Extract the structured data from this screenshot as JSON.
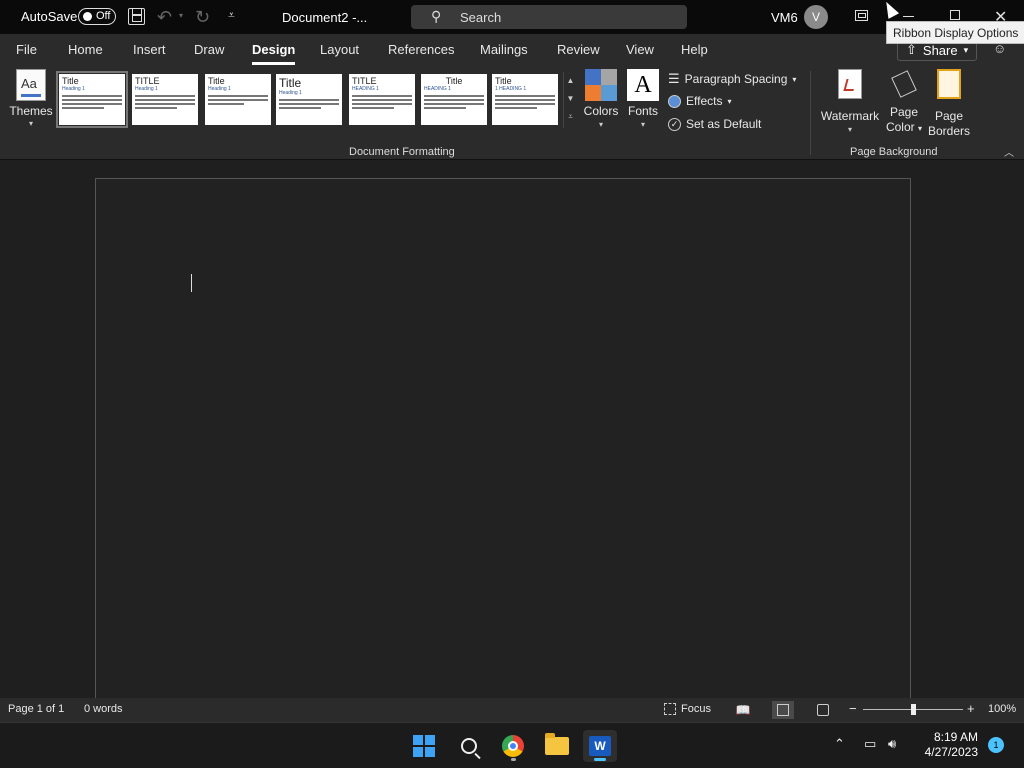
{
  "titlebar": {
    "autosave_label": "AutoSave",
    "autosave_state": "Off",
    "doc_title": "Document2  -...",
    "search_placeholder": "Search",
    "user_name": "VM6",
    "avatar_initial": "V",
    "tooltip": "Ribbon Display Options"
  },
  "tabs": [
    "File",
    "Home",
    "Insert",
    "Draw",
    "Design",
    "Layout",
    "References",
    "Mailings",
    "Review",
    "View",
    "Help"
  ],
  "active_tab": "Design",
  "share_label": "Share",
  "ribbon": {
    "themes_label": "Themes",
    "style_gallery": [
      {
        "title": "Title",
        "heading": "Heading 1"
      },
      {
        "title": "TITLE",
        "heading": "Heading 1"
      },
      {
        "title": "Title",
        "heading": "Heading 1"
      },
      {
        "title": "Title",
        "heading": "Heading 1"
      },
      {
        "title": "TITLE",
        "heading": "HEADING 1"
      },
      {
        "title": "Title",
        "heading": "HEADING 1"
      },
      {
        "title": "Title",
        "heading": "1  HEADING 1"
      }
    ],
    "colors_label": "Colors",
    "fonts_label": "Fonts",
    "fonts_glyph": "A",
    "paragraph_spacing_label": "Paragraph Spacing",
    "effects_label": "Effects",
    "set_default_label": "Set as Default",
    "watermark_label": "Watermark",
    "page_color_label1": "Page",
    "page_color_label2": "Color",
    "page_borders_label1": "Page",
    "page_borders_label2": "Borders",
    "group_document_formatting": "Document Formatting",
    "group_page_background": "Page Background",
    "colors": {
      "swatch1": "#4472c4",
      "swatch2": "#a5a5a5",
      "swatch3": "#ed7d31",
      "swatch4": "#5b9bd5"
    }
  },
  "statusbar": {
    "page_info": "Page 1 of 1",
    "word_count": "0 words",
    "focus_label": "Focus",
    "zoom_minus": "−",
    "zoom_plus": "+",
    "zoom_level": "100%",
    "zoom_fraction": 0.5
  },
  "taskbar": {
    "time": "8:19 AM",
    "date": "4/27/2023",
    "notification_count": "1",
    "word_glyph": "W"
  }
}
